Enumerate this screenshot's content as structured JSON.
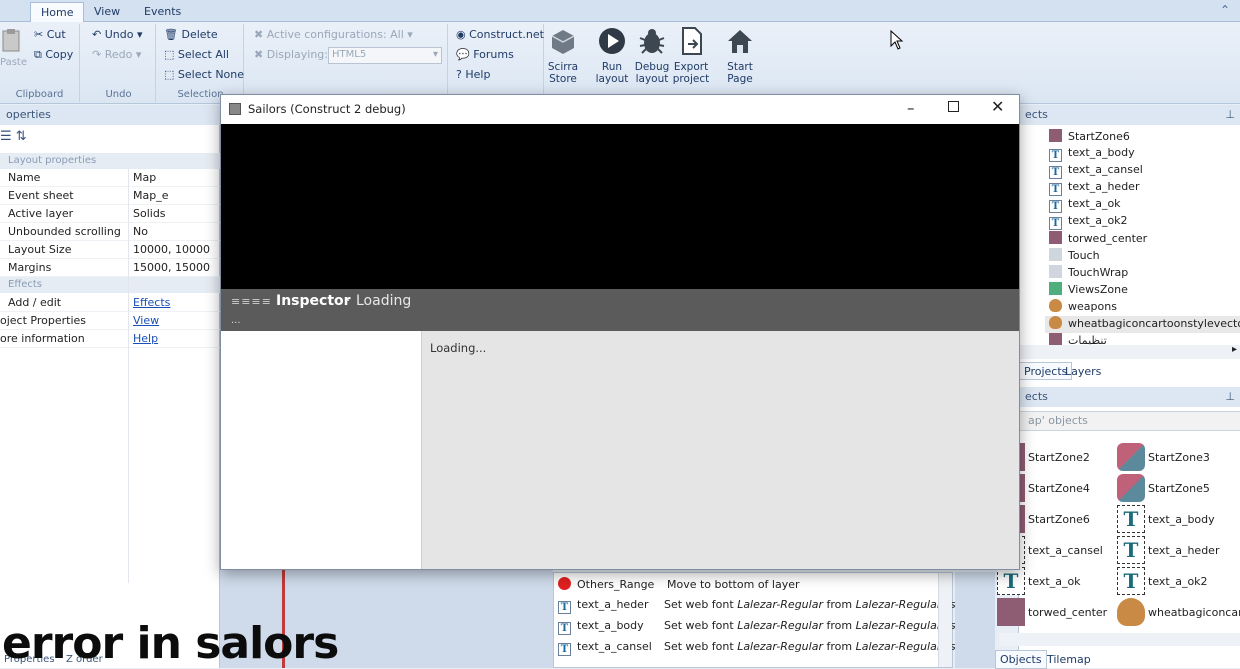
{
  "ribbon": {
    "tabs": [
      "Home",
      "View",
      "Events"
    ],
    "clipboard": {
      "paste": "Paste",
      "cut": "Cut",
      "copy": "Copy",
      "label": "Clipboard"
    },
    "undo": {
      "undo": "Undo",
      "redo": "Redo",
      "label": "Undo"
    },
    "selection": {
      "delete": "Delete",
      "select_all": "Select All",
      "select_none": "Select None",
      "label": "Selection"
    },
    "config": {
      "active_configs": "Active configurations: All",
      "displaying": "Displaying:",
      "displaying_value": "HTML5"
    },
    "online": {
      "construct": "Construct.net",
      "forums": "Forums",
      "help": "Help"
    },
    "big": [
      {
        "label1": "Scirra",
        "label2": "Store"
      },
      {
        "label1": "Run",
        "label2": "layout"
      },
      {
        "label1": "Debug",
        "label2": "layout"
      },
      {
        "label1": "Export",
        "label2": "project"
      },
      {
        "label1": "Start",
        "label2": "Page"
      }
    ]
  },
  "properties": {
    "title": "operties",
    "section_layout": "Layout properties",
    "rows": [
      {
        "k": "Name",
        "v": "Map"
      },
      {
        "k": "Event sheet",
        "v": "Map_e"
      },
      {
        "k": "Active layer",
        "v": "Solids"
      },
      {
        "k": "Unbounded scrolling",
        "v": "No"
      },
      {
        "k": "Layout Size",
        "v": "10000, 10000"
      },
      {
        "k": "Margins",
        "v": "15000, 15000"
      }
    ],
    "section_effects": "Effects",
    "links": [
      {
        "k": "Add / edit",
        "v": "Effects"
      },
      {
        "k": "oject Properties",
        "v": "View"
      },
      {
        "k": "ore information",
        "v": "Help"
      }
    ],
    "bottom_tabs": [
      "Properties",
      "Z order"
    ]
  },
  "objects_top": {
    "title": "ects",
    "items": [
      {
        "name": "StartZone6",
        "icon": "sprite"
      },
      {
        "name": "text_a_body",
        "icon": "text"
      },
      {
        "name": "text_a_cansel",
        "icon": "text"
      },
      {
        "name": "text_a_heder",
        "icon": "text"
      },
      {
        "name": "text_a_ok",
        "icon": "text"
      },
      {
        "name": "text_a_ok2",
        "icon": "text"
      },
      {
        "name": "torwed_center",
        "icon": "sprite"
      },
      {
        "name": "Touch",
        "icon": "touch"
      },
      {
        "name": "TouchWrap",
        "icon": "touch"
      },
      {
        "name": "ViewsZone",
        "icon": "green"
      },
      {
        "name": "weapons",
        "icon": "bag"
      },
      {
        "name": "wheatbagiconcartoonstylevector",
        "icon": "bag"
      },
      {
        "name": "تنظیمات",
        "icon": "sprite"
      }
    ],
    "tabs": [
      "Projects",
      "Layers"
    ]
  },
  "objects_grid": {
    "title": "ects",
    "filter": "ap' objects",
    "items": [
      {
        "name": "StartZone2",
        "kind": "sprite"
      },
      {
        "name": "StartZone3",
        "kind": "zone"
      },
      {
        "name": "StartZone4",
        "kind": "sprite"
      },
      {
        "name": "StartZone5",
        "kind": "zone"
      },
      {
        "name": "StartZone6",
        "kind": "sprite"
      },
      {
        "name": "text_a_body",
        "kind": "text"
      },
      {
        "name": "text_a_cansel",
        "kind": "text"
      },
      {
        "name": "text_a_heder",
        "kind": "text"
      },
      {
        "name": "text_a_ok",
        "kind": "text"
      },
      {
        "name": "text_a_ok2",
        "kind": "text"
      },
      {
        "name": "torwed_center",
        "kind": "sprite"
      },
      {
        "name": "wheatbagiconcart",
        "kind": "bag"
      }
    ],
    "tabs": [
      "Objects",
      "Tilemap"
    ]
  },
  "events": [
    {
      "obj": "Others_Range",
      "action": "Move to bottom of layer",
      "icon": "red"
    },
    {
      "obj": "text_a_heder",
      "action_pre": "Set web font ",
      "font": "Lalezar-Regular",
      "mid": " from ",
      "file": "Lalezar-Regular.css",
      "icon": "text"
    },
    {
      "obj": "text_a_body",
      "action_pre": "Set web font ",
      "font": "Lalezar-Regular",
      "mid": " from ",
      "file": "Lalezar-Regular.css",
      "icon": "text"
    },
    {
      "obj": "text_a_cansel",
      "action_pre": "Set web font ",
      "font": "Lalezar-Regular",
      "mid": " from ",
      "file": "Lalezar-Regular.css",
      "icon": "text"
    }
  ],
  "debug": {
    "title": "Sailors (Construct 2 debug)",
    "inspector": "Inspector",
    "sep": "·",
    "status": "Loading",
    "dots": "...",
    "content": "Loading..."
  },
  "overlay": "error in salors"
}
